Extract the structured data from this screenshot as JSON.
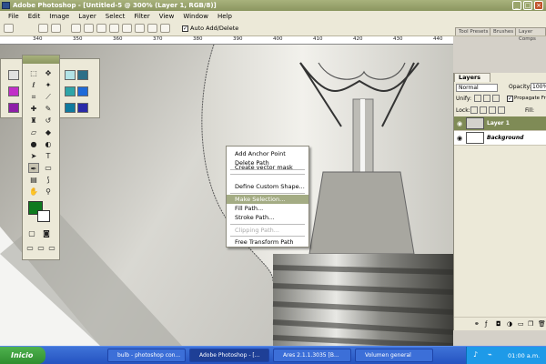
{
  "window": {
    "title": "Adobe Photoshop - [Untitled-5 @ 300% (Layer 1, RGB/8)]"
  },
  "menubar": {
    "items": [
      "File",
      "Edit",
      "Image",
      "Layer",
      "Select",
      "Filter",
      "View",
      "Window",
      "Help"
    ]
  },
  "options": {
    "auto_add_label": "Auto Add/Delete",
    "auto_add_checked": "✓",
    "tabs": [
      "Tool Presets",
      "Brushes",
      "Layer Comps"
    ]
  },
  "ruler": {
    "labels": [
      "340",
      "350",
      "360",
      "370",
      "380",
      "390",
      "400",
      "410",
      "420",
      "430",
      "440"
    ]
  },
  "context_menu": {
    "items": [
      {
        "label": "Add Anchor Point",
        "state": "normal"
      },
      {
        "label": "Delete Path",
        "state": "normal"
      },
      {
        "label": "Create vector mask",
        "state": "normal"
      },
      {
        "label": "Define Custom Shape...",
        "state": "normal"
      },
      {
        "label": "Make Selection...",
        "state": "highlighted"
      },
      {
        "label": "Fill Path...",
        "state": "normal"
      },
      {
        "label": "Stroke Path...",
        "state": "normal"
      },
      {
        "label": "Clipping Path...",
        "state": "disabled"
      },
      {
        "label": "Free Transform Path",
        "state": "normal"
      }
    ]
  },
  "layers_panel": {
    "tab_label": "Layers",
    "blend_mode": "Normal",
    "opacity_label": "Opacity:",
    "opacity_value": "100%",
    "unify_label": "Unify:",
    "propagate_label": "Propagate Fr",
    "propagate_checked": "✓",
    "lock_label": "Lock:",
    "fill_label": "Fill:",
    "layers": [
      {
        "name": "Layer 1",
        "selected": true
      },
      {
        "name": "Background",
        "selected": false
      }
    ]
  },
  "colors": {
    "foreground": "#0e7a1e",
    "background": "#ffffff",
    "accent": "#8b9660"
  },
  "taskbar": {
    "start_label": "Inicio",
    "tasks": [
      {
        "label": "bulb - photoshop con...",
        "active": false
      },
      {
        "label": "Adobe Photoshop - [...",
        "active": true
      },
      {
        "label": "Ares 2.1.1.3035 [B...",
        "active": false
      },
      {
        "label": "Volumen general",
        "active": false
      }
    ],
    "clock": "01:00 a.m."
  }
}
